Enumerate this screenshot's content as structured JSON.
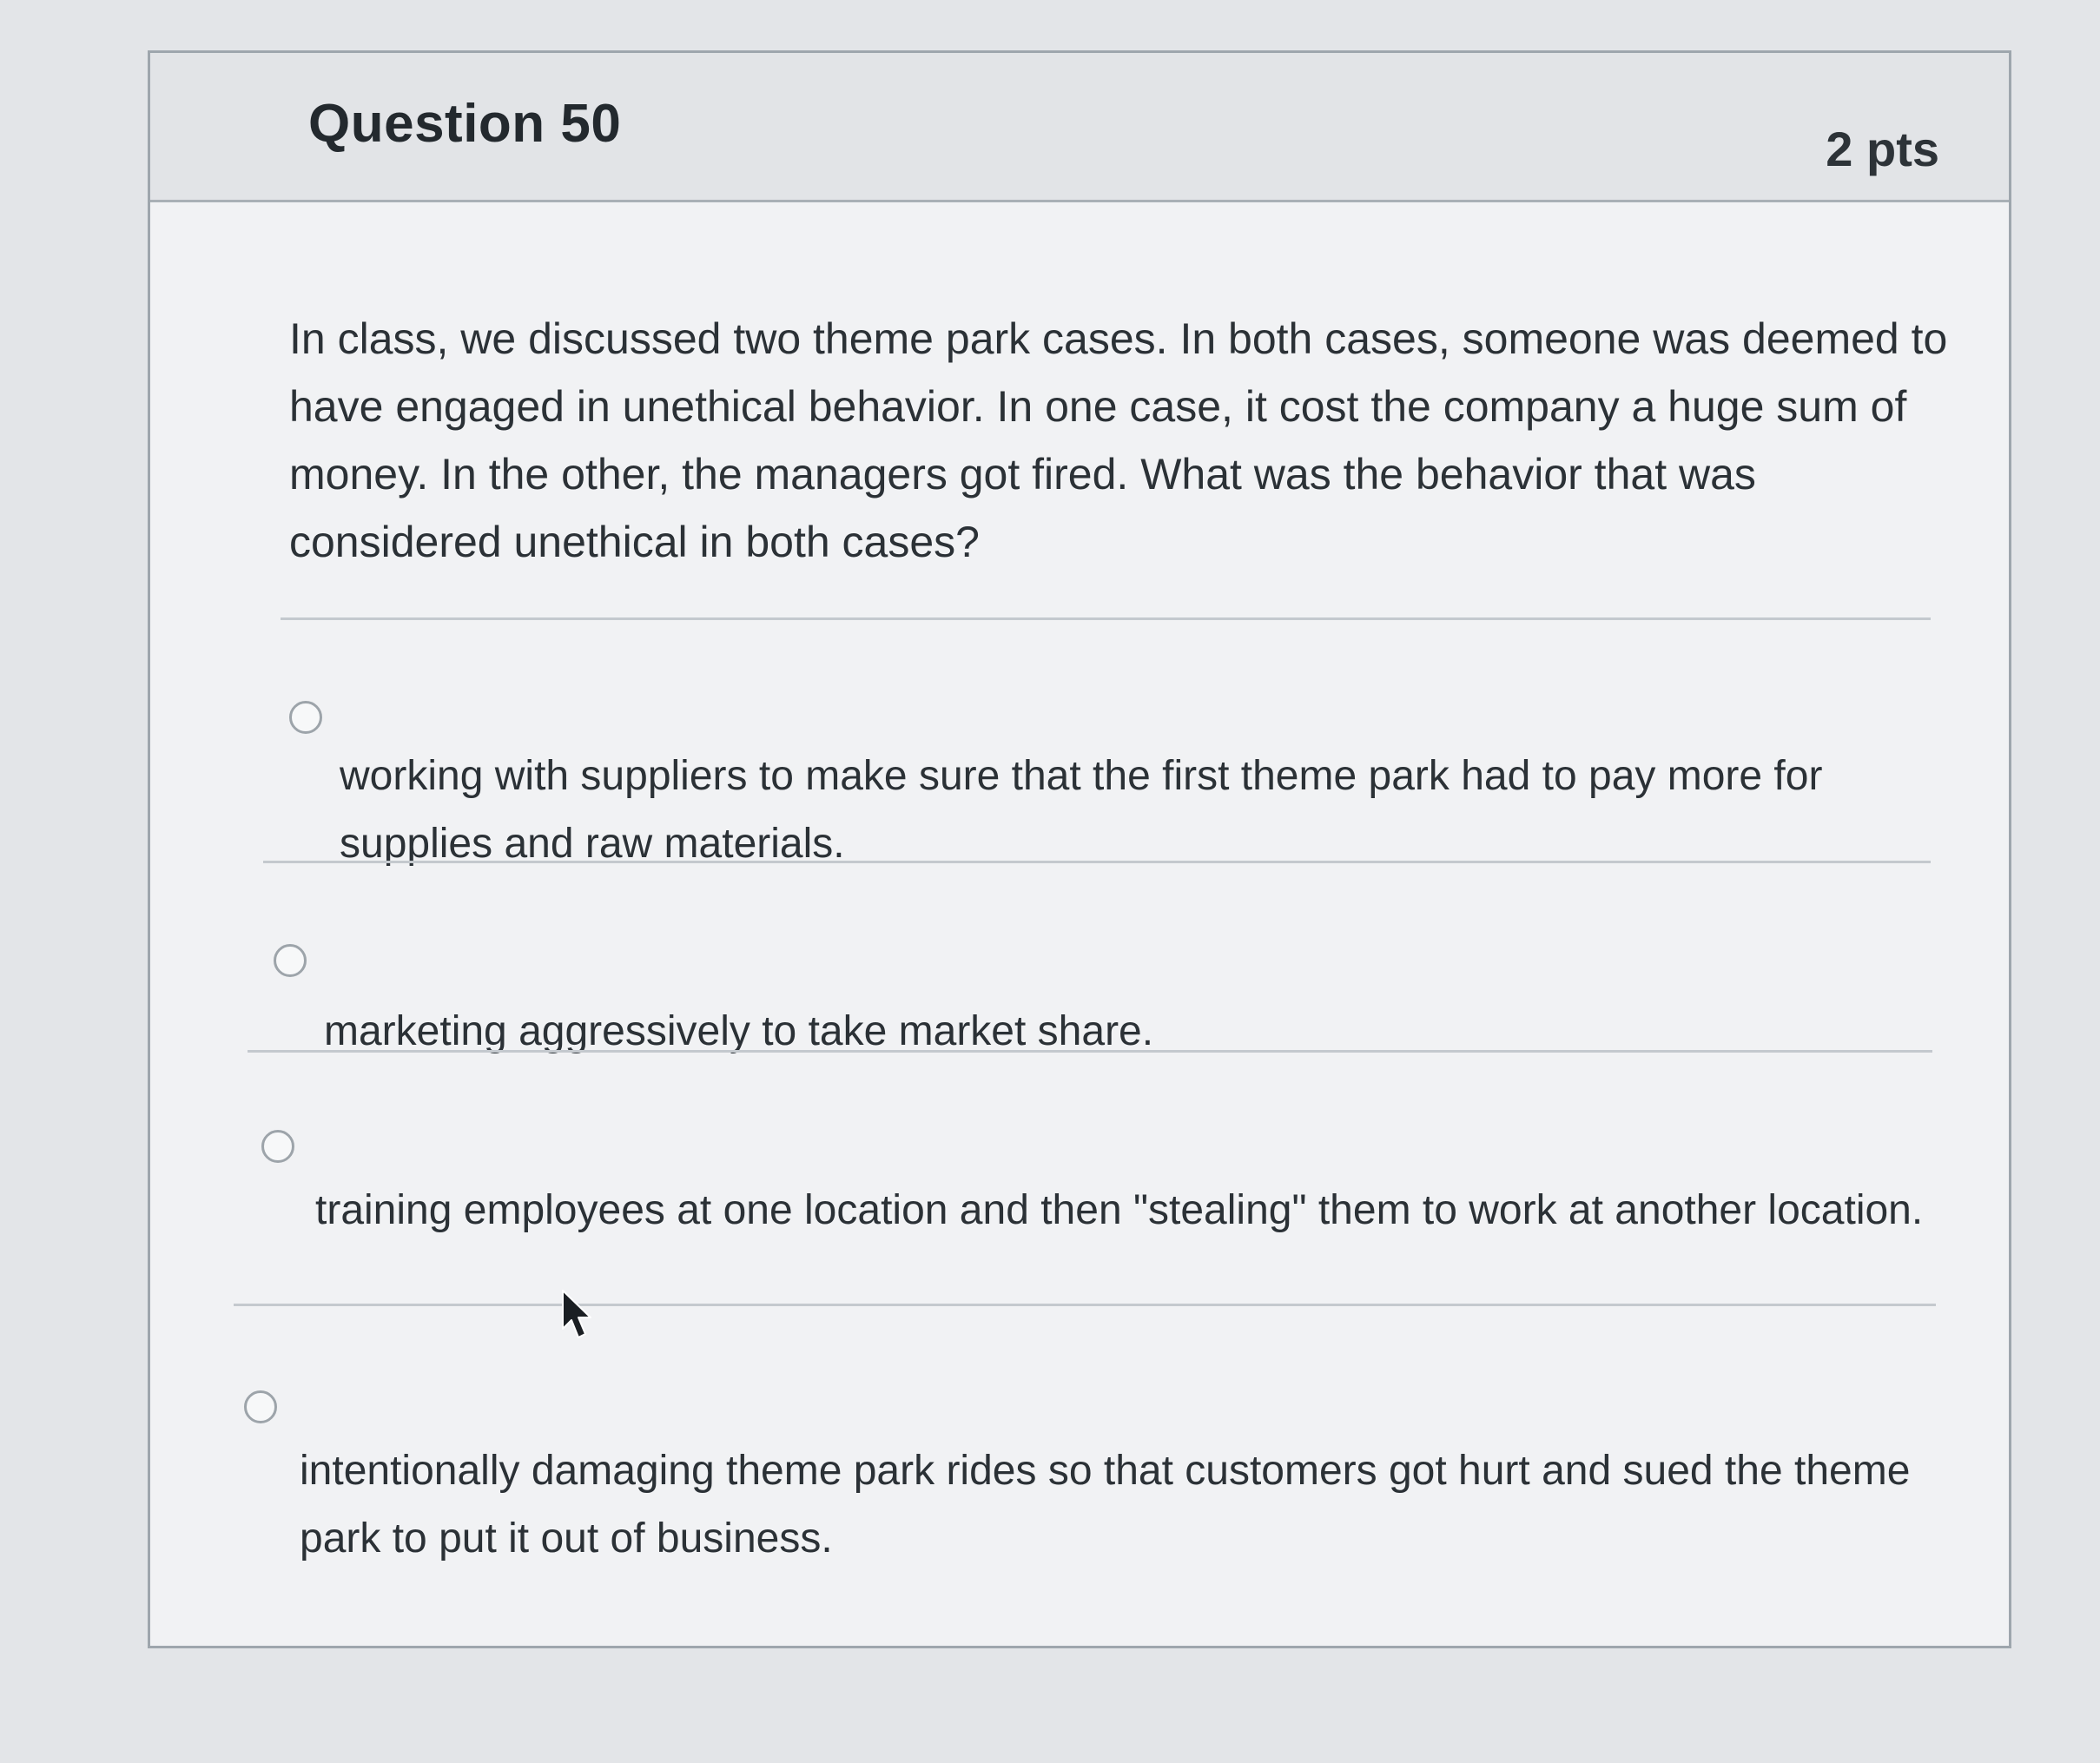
{
  "question": {
    "title": "Question 50",
    "points": "2 pts",
    "text": "In class, we discussed two theme park cases. In both cases, someone was deemed to have engaged in unethical behavior. In one case, it cost the company a huge sum of money. In the other, the managers got fired.  What was the behavior that was considered unethical in both cases?"
  },
  "answers": [
    {
      "label": "working with suppliers to make sure that the first theme park had to pay more for supplies and raw materials."
    },
    {
      "label": "marketing aggressively to take market share."
    },
    {
      "label": "training employees at one location and then \"stealing\" them to work at another location."
    },
    {
      "label": "intentionally damaging theme park rides so that customers got hurt and sued the theme park to put it out of business."
    }
  ],
  "colors": {
    "text": "#2b3136",
    "border": "#9ea6ad",
    "header_bg": "#e2e4e7"
  },
  "icons": {
    "flag": "bookmark-flag-icon",
    "radio": "radio-button-icon",
    "cursor": "mouse-cursor-icon"
  }
}
